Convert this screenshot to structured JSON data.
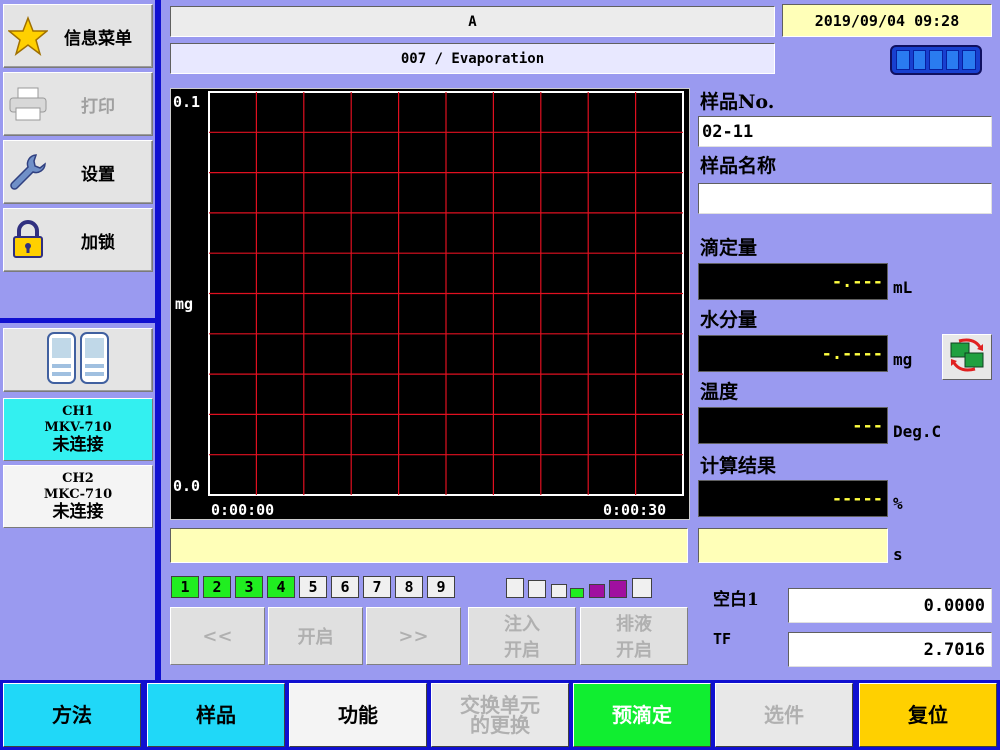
{
  "sidebar": {
    "items": [
      {
        "label": "信息菜单",
        "icon": "star-icon"
      },
      {
        "label": "打印",
        "icon": "printer-icon",
        "disabled": true
      },
      {
        "label": "设置",
        "icon": "wrench-icon"
      },
      {
        "label": "加锁",
        "icon": "lock-icon"
      }
    ],
    "channels": [
      {
        "name": "CH1",
        "model": "MKV-710",
        "status": "未连接",
        "color": "#33f0f0"
      },
      {
        "name": "CH2",
        "model": "MKC-710",
        "status": "未连接",
        "color": "#f4f4f4"
      }
    ]
  },
  "header": {
    "title": "A",
    "datetime": "2019/09/04 09:28",
    "method": "007 / Evaporation"
  },
  "chart_data": {
    "type": "line",
    "series": [],
    "x": [],
    "xlabel_start": "0:00:00",
    "xlabel_end": "0:00:30",
    "xlim": [
      "0:00:00",
      "0:00:30"
    ],
    "ylabel": "mg",
    "ytick_top": "0.1",
    "ytick_bottom": "0.0",
    "ylim": [
      0.0,
      0.1
    ],
    "grid": true,
    "grid_color": "#e01020",
    "background": "#000000"
  },
  "right_panel": {
    "sample_no_label": "样品No.",
    "sample_no_value": "02-11",
    "sample_name_label": "样品名称",
    "sample_name_value": "",
    "titration_label": "滴定量",
    "titration_value": "-.---",
    "titration_unit": "mL",
    "water_label": "水分量",
    "water_value": "-.----",
    "water_unit": "mg",
    "temp_label": "温度",
    "temp_value": "---",
    "temp_unit": "Deg.C",
    "result_label": "计算结果",
    "result_value": "-----",
    "result_unit": "%",
    "time_unit": "s"
  },
  "channels_row": [
    {
      "n": "1",
      "on": true
    },
    {
      "n": "2",
      "on": true
    },
    {
      "n": "3",
      "on": true
    },
    {
      "n": "4",
      "on": true
    },
    {
      "n": "5",
      "on": false
    },
    {
      "n": "6",
      "on": false
    },
    {
      "n": "7",
      "on": false
    },
    {
      "n": "8",
      "on": false
    },
    {
      "n": "9",
      "on": false
    }
  ],
  "actions": {
    "prev": "<<",
    "start": "开启",
    "next": ">>",
    "inject_l1": "注入",
    "inject_l2": "开启",
    "drain_l1": "排液",
    "drain_l2": "开启"
  },
  "blank": {
    "label": "空白1",
    "value": "0.0000"
  },
  "tf": {
    "label": "TF",
    "value": "2.7016"
  },
  "bottom": [
    {
      "label": "方法",
      "color": "#20d8f8"
    },
    {
      "label": "样品",
      "color": "#20d8f8"
    },
    {
      "label": "功能",
      "color": "#f4f4f4"
    },
    {
      "label": "交换单元的更换",
      "color": "#e8e8e8",
      "disabled": true
    },
    {
      "label": "预滴定",
      "color": "#10ee30",
      "text_color": "#ffffff"
    },
    {
      "label": "选件",
      "color": "#e8e8e8",
      "disabled": true
    },
    {
      "label": "复位",
      "color": "#ffd000"
    }
  ],
  "colors": {
    "accent": "#1010d0",
    "background": "#9a9af0"
  }
}
